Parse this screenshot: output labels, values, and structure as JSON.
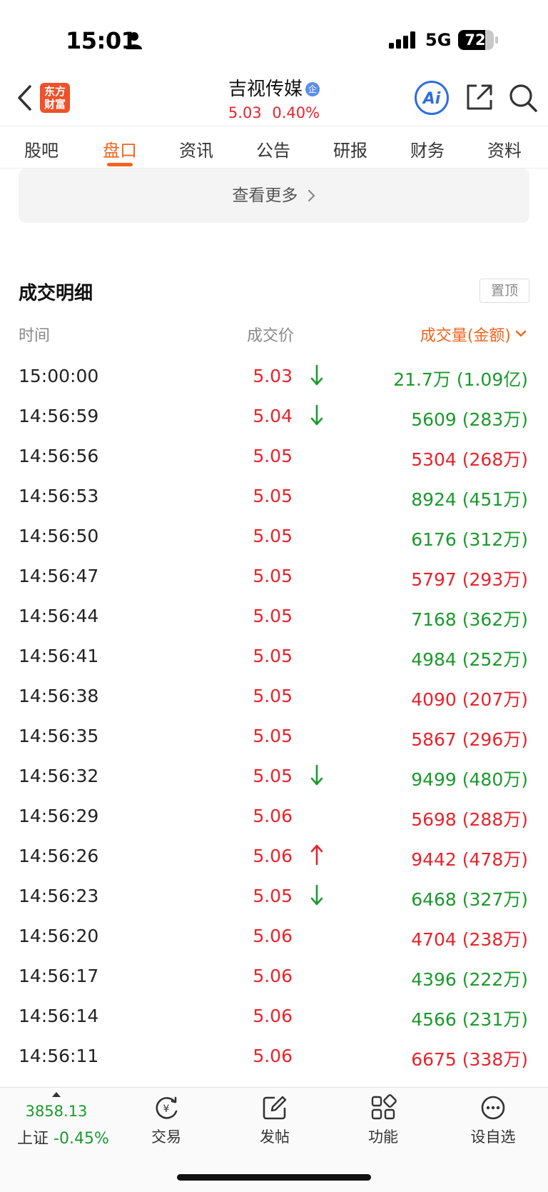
{
  "status_bar": {
    "time": "15:01",
    "network": "5G",
    "battery": "72"
  },
  "header": {
    "logo_line1": "东方",
    "logo_line2": "财富",
    "stock_name": "吉视传媒",
    "badge": "企",
    "price": "5.03",
    "change_pct": "0.40%"
  },
  "tabs": [
    "股吧",
    "盘口",
    "资讯",
    "公告",
    "研报",
    "财务",
    "资料"
  ],
  "active_tab": "盘口",
  "view_more_label": "查看更多",
  "section": {
    "title": "成交明细",
    "pin_label": "置顶",
    "col_time": "时间",
    "col_price": "成交价",
    "col_volume": "成交量(金额)"
  },
  "trades": [
    {
      "time": "15:00:00",
      "price": "5.03",
      "arrow": "down",
      "volume": "21.7万 (1.09亿)",
      "side": "sell"
    },
    {
      "time": "14:56:59",
      "price": "5.04",
      "arrow": "down",
      "volume": "5609 (283万)",
      "side": "sell"
    },
    {
      "time": "14:56:56",
      "price": "5.05",
      "arrow": "",
      "volume": "5304 (268万)",
      "side": "buy"
    },
    {
      "time": "14:56:53",
      "price": "5.05",
      "arrow": "",
      "volume": "8924 (451万)",
      "side": "sell"
    },
    {
      "time": "14:56:50",
      "price": "5.05",
      "arrow": "",
      "volume": "6176 (312万)",
      "side": "sell"
    },
    {
      "time": "14:56:47",
      "price": "5.05",
      "arrow": "",
      "volume": "5797 (293万)",
      "side": "buy"
    },
    {
      "time": "14:56:44",
      "price": "5.05",
      "arrow": "",
      "volume": "7168 (362万)",
      "side": "sell"
    },
    {
      "time": "14:56:41",
      "price": "5.05",
      "arrow": "",
      "volume": "4984 (252万)",
      "side": "sell"
    },
    {
      "time": "14:56:38",
      "price": "5.05",
      "arrow": "",
      "volume": "4090 (207万)",
      "side": "buy"
    },
    {
      "time": "14:56:35",
      "price": "5.05",
      "arrow": "",
      "volume": "5867 (296万)",
      "side": "buy"
    },
    {
      "time": "14:56:32",
      "price": "5.05",
      "arrow": "down",
      "volume": "9499 (480万)",
      "side": "sell"
    },
    {
      "time": "14:56:29",
      "price": "5.06",
      "arrow": "",
      "volume": "5698 (288万)",
      "side": "buy"
    },
    {
      "time": "14:56:26",
      "price": "5.06",
      "arrow": "up",
      "volume": "9442 (478万)",
      "side": "buy"
    },
    {
      "time": "14:56:23",
      "price": "5.05",
      "arrow": "down",
      "volume": "6468 (327万)",
      "side": "sell"
    },
    {
      "time": "14:56:20",
      "price": "5.06",
      "arrow": "",
      "volume": "4704 (238万)",
      "side": "buy"
    },
    {
      "time": "14:56:17",
      "price": "5.06",
      "arrow": "",
      "volume": "4396 (222万)",
      "side": "sell"
    },
    {
      "time": "14:56:14",
      "price": "5.06",
      "arrow": "",
      "volume": "4566 (231万)",
      "side": "sell"
    },
    {
      "time": "14:56:11",
      "price": "5.06",
      "arrow": "",
      "volume": "6675 (338万)",
      "side": "buy"
    }
  ],
  "bottom": {
    "index_value": "3858.13",
    "index_name": "上证",
    "index_change": "-0.45%",
    "nav": [
      {
        "label": "交易",
        "icon": "trade-icon"
      },
      {
        "label": "发帖",
        "icon": "compose-icon"
      },
      {
        "label": "功能",
        "icon": "grid-icon"
      },
      {
        "label": "设自选",
        "icon": "more-icon"
      }
    ]
  },
  "colors": {
    "up": "#e8232b",
    "down": "#1a9a2c",
    "accent": "#f0641e",
    "brand": "#f0512a"
  }
}
